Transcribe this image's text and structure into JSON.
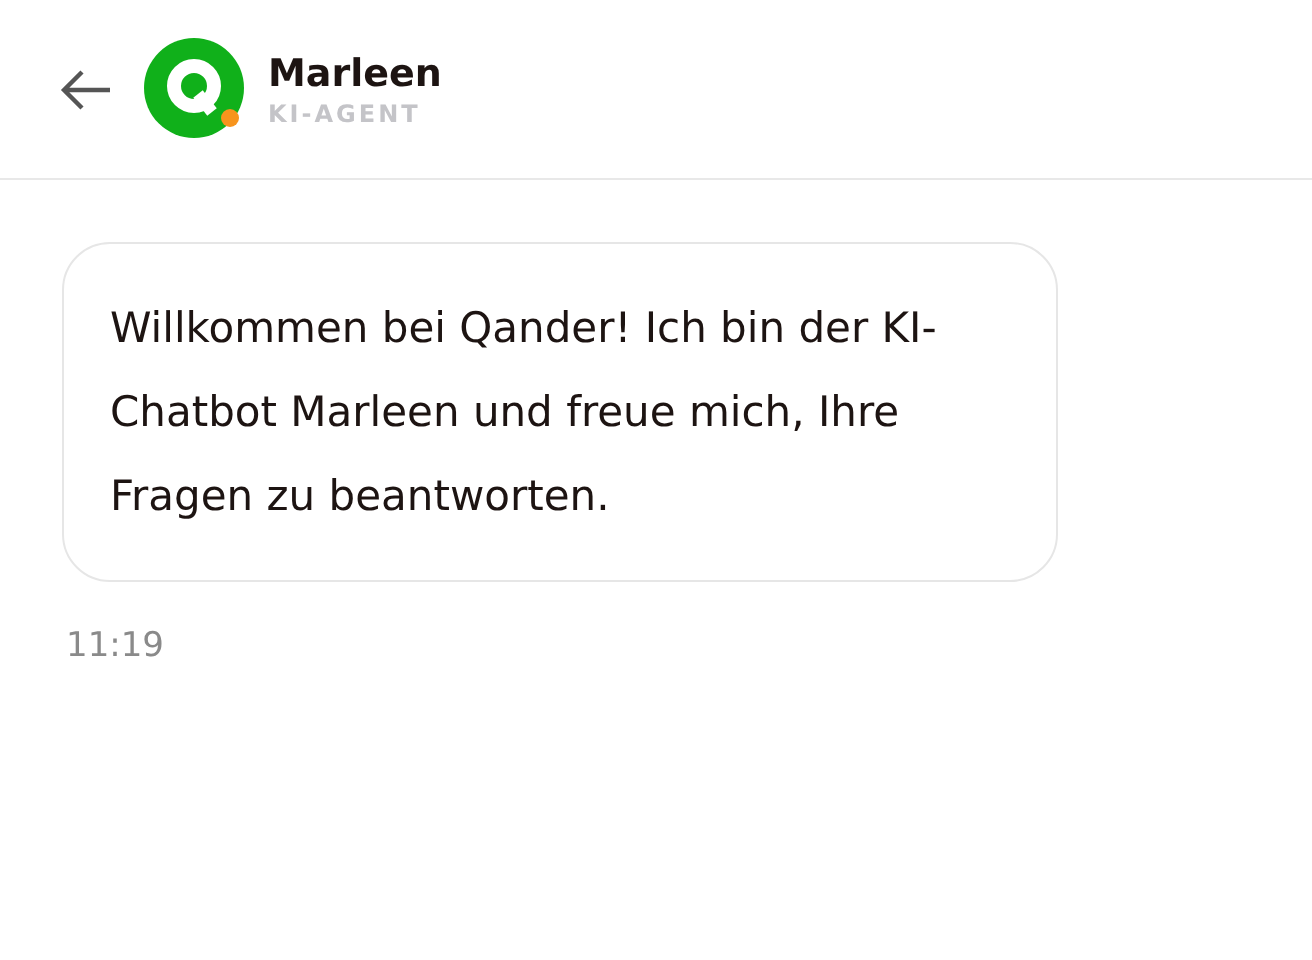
{
  "header": {
    "name": "Marleen",
    "role": "KI-AGENT",
    "online": true
  },
  "messages": [
    {
      "text": "Willkommen bei Qander! Ich bin der KI-Chatbot Marleen und freue mich, Ihre Fragen zu beantworten.",
      "time": "11:19"
    }
  ]
}
